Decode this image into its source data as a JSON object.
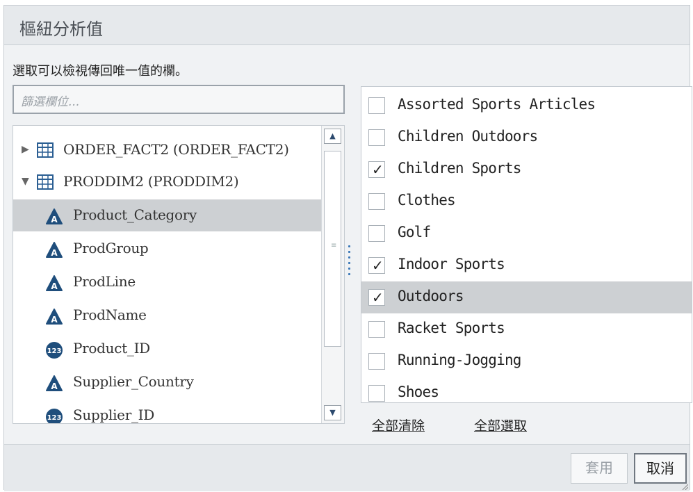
{
  "dialog": {
    "title": "樞紐分析值",
    "instruction": "選取可以檢視傳回唯一值的欄。",
    "filter_placeholder": "篩選欄位..."
  },
  "tree": {
    "tables": [
      {
        "name": "ORDER_FACT2 (ORDER_FACT2)",
        "expanded": false
      },
      {
        "name": "PRODDIM2 (PRODDIM2)",
        "expanded": true
      }
    ],
    "columns": [
      {
        "name": "Product_Category",
        "type": "character",
        "badge": "A",
        "selected": true
      },
      {
        "name": "ProdGroup",
        "type": "character",
        "badge": "A",
        "selected": false
      },
      {
        "name": "ProdLine",
        "type": "character",
        "badge": "A",
        "selected": false
      },
      {
        "name": "ProdName",
        "type": "character",
        "badge": "A",
        "selected": false
      },
      {
        "name": "Product_ID",
        "type": "numeric",
        "badge": "123",
        "selected": false
      },
      {
        "name": "Supplier_Country",
        "type": "character",
        "badge": "A",
        "selected": false
      },
      {
        "name": "Supplier_ID",
        "type": "numeric",
        "badge": "123",
        "selected": false
      }
    ]
  },
  "values": [
    {
      "label": "Assorted Sports Articles",
      "checked": false,
      "highlighted": false
    },
    {
      "label": "Children Outdoors",
      "checked": false,
      "highlighted": false
    },
    {
      "label": "Children Sports",
      "checked": true,
      "highlighted": false
    },
    {
      "label": "Clothes",
      "checked": false,
      "highlighted": false
    },
    {
      "label": "Golf",
      "checked": false,
      "highlighted": false
    },
    {
      "label": "Indoor Sports",
      "checked": true,
      "highlighted": false
    },
    {
      "label": "Outdoors",
      "checked": true,
      "highlighted": true
    },
    {
      "label": "Racket Sports",
      "checked": false,
      "highlighted": false
    },
    {
      "label": "Running-Jogging",
      "checked": false,
      "highlighted": false
    },
    {
      "label": "Shoes",
      "checked": false,
      "highlighted": false
    }
  ],
  "links": {
    "clear_all": "全部清除",
    "select_all": "全部選取"
  },
  "buttons": {
    "apply": "套用",
    "cancel": "取消"
  },
  "colors": {
    "badge": "#1f4e7c",
    "table_icon": "#2b5f93",
    "splitter": "#3a78b8",
    "selection": "#cdd0d3"
  }
}
